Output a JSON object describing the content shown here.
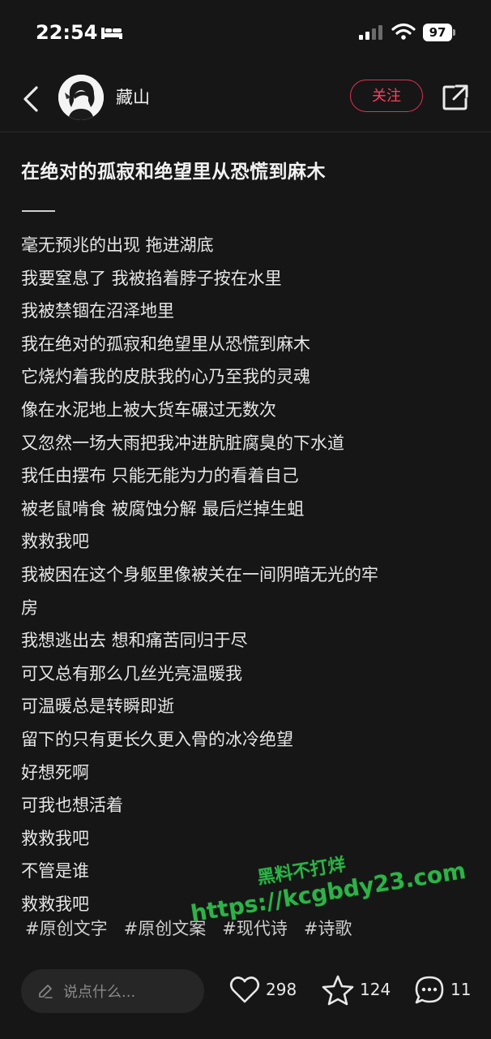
{
  "status_bar": {
    "time": "22:54",
    "battery": "97"
  },
  "header": {
    "username": "藏山",
    "follow_label": "关注"
  },
  "post": {
    "title": "在绝对的孤寂和绝望里从恐慌到麻木",
    "lines": [
      "毫无预兆的出现 拖进湖底",
      "我要窒息了 我被掐着脖子按在水里",
      "我被禁锢在沼泽地里",
      "我在绝对的孤寂和绝望里从恐慌到麻木",
      "它烧灼着我的皮肤我的心乃至我的灵魂",
      "像在水泥地上被大货车碾过无数次",
      "又忽然一场大雨把我冲进肮脏腐臭的下水道",
      "我任由摆布 只能无能为力的看着自己",
      "被老鼠啃食 被腐蚀分解 最后烂掉生蛆",
      "救救我吧",
      "我被困在这个身躯里像被关在一间阴暗无光的牢",
      "房",
      "我想逃出去 想和痛苦同归于尽",
      "可又总有那么几丝光亮温暖我",
      "可温暖总是转瞬即逝",
      "留下的只有更长久更入骨的冰冷绝望",
      "好想死啊",
      "可我也想活着",
      "救救我吧",
      "不管是谁",
      "救救我吧"
    ],
    "tags": [
      "#原创文字",
      "#原创文案",
      "#现代诗",
      "#诗歌"
    ]
  },
  "watermark": {
    "text": "黑料不打烊",
    "url": "https://kcgbdy23.com"
  },
  "bottom_bar": {
    "comment_placeholder": "说点什么...",
    "likes": "298",
    "favorites": "124",
    "comments": "11"
  },
  "colors": {
    "background": "#161616",
    "accent": "#ff3e60",
    "watermark": "#2fb14a"
  }
}
